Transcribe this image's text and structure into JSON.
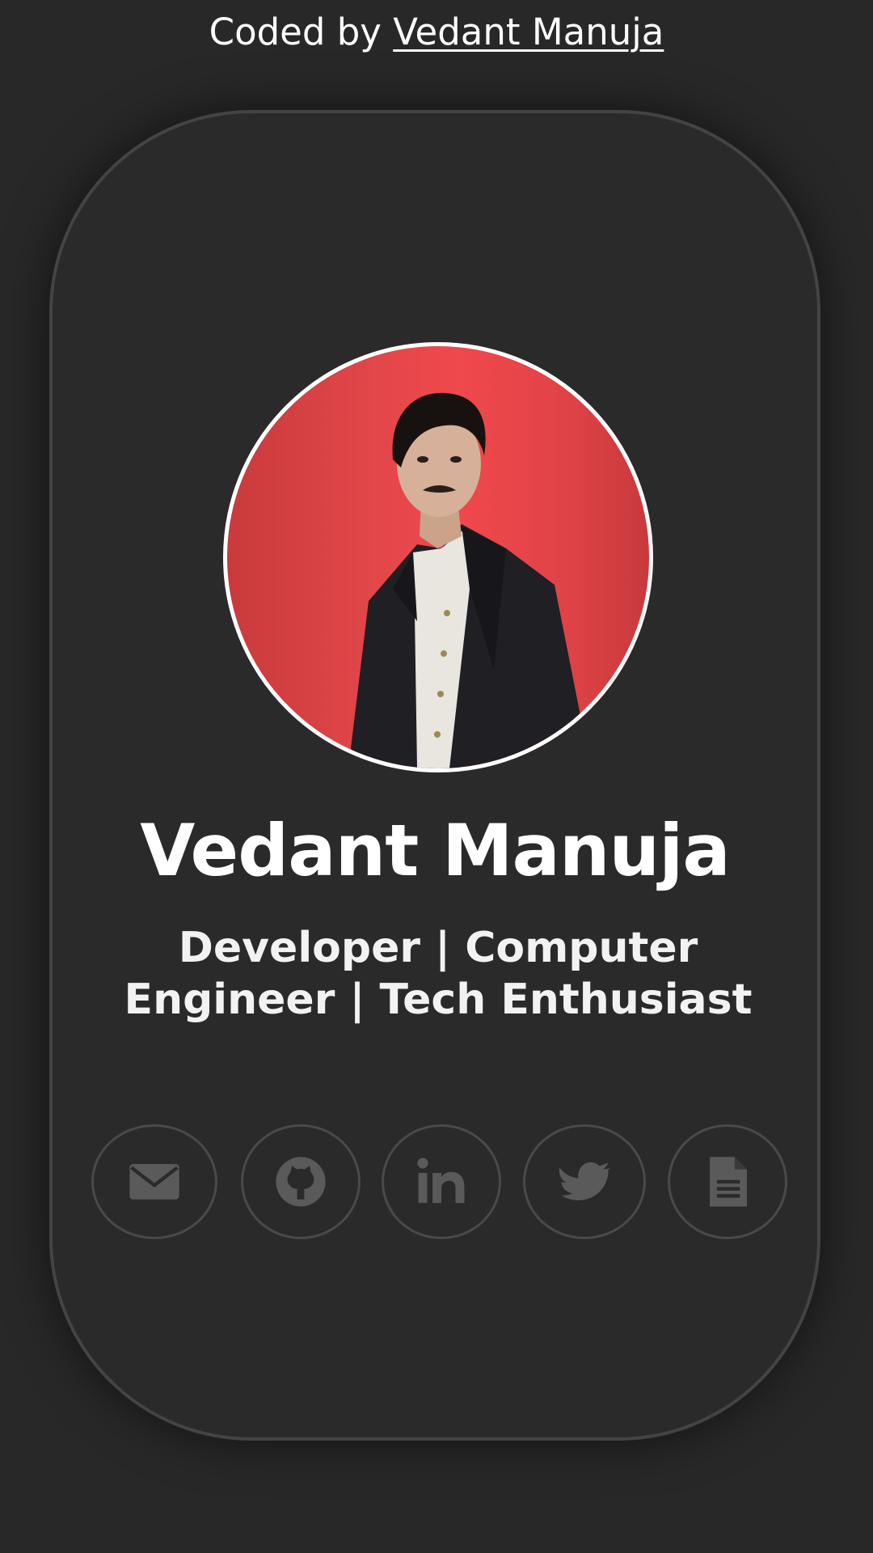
{
  "credit": {
    "prefix": "Coded by ",
    "author_link": "Vedant Manuja"
  },
  "profile": {
    "name": "Vedant Manuja",
    "tagline": "Developer | Computer Engineer | Tech Enthusiast",
    "avatar_icon": "profile-photo"
  },
  "social": [
    {
      "icon": "envelope-icon"
    },
    {
      "icon": "github-icon"
    },
    {
      "icon": "linkedin-icon"
    },
    {
      "icon": "twitter-icon"
    },
    {
      "icon": "document-icon"
    }
  ],
  "colors": {
    "background": "#282828",
    "card": "#2a2a2a",
    "card_border": "#444444",
    "avatar_bg": "#e2474a",
    "text": "#ffffff",
    "icon": "#5a5a5a"
  }
}
